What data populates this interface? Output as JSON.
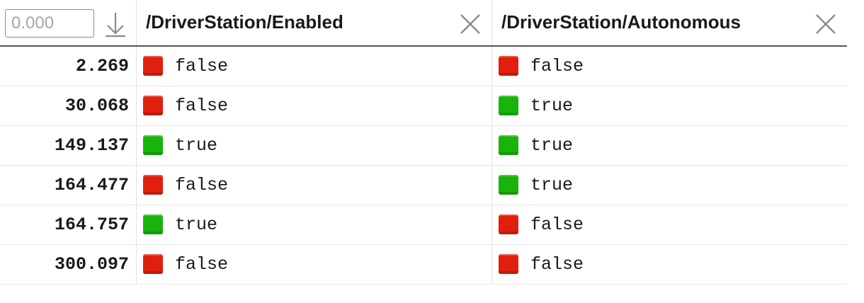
{
  "toolbar": {
    "time_placeholder": "0.000"
  },
  "colors": {
    "true": "#19b40a",
    "false": "#e0200d"
  },
  "columns": [
    {
      "title": "/DriverStation/Enabled"
    },
    {
      "title": "/DriverStation/Autonomous"
    }
  ],
  "rows": [
    {
      "time": "2.269",
      "values": [
        "false",
        "false"
      ]
    },
    {
      "time": "30.068",
      "values": [
        "false",
        "true"
      ]
    },
    {
      "time": "149.137",
      "values": [
        "true",
        "true"
      ]
    },
    {
      "time": "164.477",
      "values": [
        "false",
        "true"
      ]
    },
    {
      "time": "164.757",
      "values": [
        "true",
        "false"
      ]
    },
    {
      "time": "300.097",
      "values": [
        "false",
        "false"
      ]
    }
  ]
}
